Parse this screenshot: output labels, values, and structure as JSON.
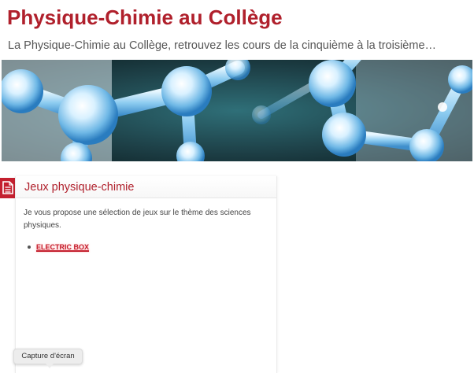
{
  "site": {
    "title": "Physique-Chimie au Collège",
    "description": "La Physique-Chimie au Collège, retrouvez les cours de la cinquième à la troisième…"
  },
  "banner": {
    "image": "molecule-banner"
  },
  "post": {
    "icon": "document-icon",
    "title": "Jeux physique-chimie",
    "intro": "Je vous propose une sélection de jeux sur le thème des sciences physiques.",
    "links": [
      {
        "label": "ELECTRIC BOX"
      }
    ]
  },
  "tooltip": {
    "label": "Capture d'écran"
  },
  "colors": {
    "accent": "#b0202c",
    "icon_bg": "#c4202f"
  }
}
